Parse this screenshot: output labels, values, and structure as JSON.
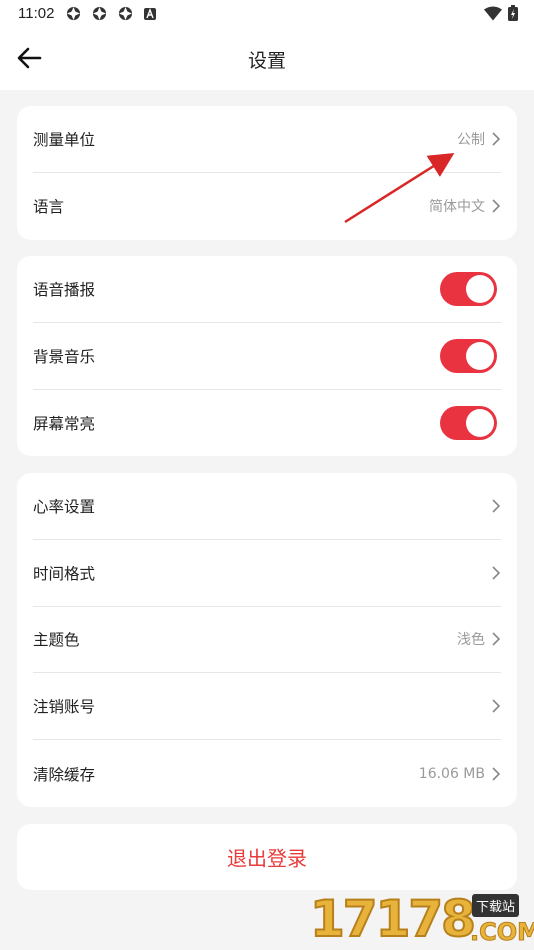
{
  "status_bar": {
    "time": "11:02",
    "icons": [
      "app-icon",
      "app-icon",
      "app-icon",
      "a-badge-icon",
      "wifi-icon",
      "battery-charging-icon"
    ]
  },
  "header": {
    "title": "设置",
    "back_icon": "arrow-left-icon"
  },
  "card_units": [
    {
      "label": "测量单位",
      "value": "公制"
    },
    {
      "label": "语言",
      "value": "简体中文"
    }
  ],
  "card_toggles": [
    {
      "label": "语音播报",
      "on": true
    },
    {
      "label": "背景音乐",
      "on": true
    },
    {
      "label": "屏幕常亮",
      "on": true
    }
  ],
  "card_more": [
    {
      "label": "心率设置",
      "value": ""
    },
    {
      "label": "时间格式",
      "value": ""
    },
    {
      "label": "主题色",
      "value": "浅色"
    },
    {
      "label": "注销账号",
      "value": ""
    },
    {
      "label": "清除缓存",
      "value": "16.06 MB"
    }
  ],
  "logout_label": "退出登录",
  "colors": {
    "accent": "#ea3341",
    "logout_text": "#e83b3b",
    "background": "#f4f4f4"
  },
  "watermark": {
    "digits": "17178",
    "tag": "下载站",
    "domain": ".COM"
  }
}
